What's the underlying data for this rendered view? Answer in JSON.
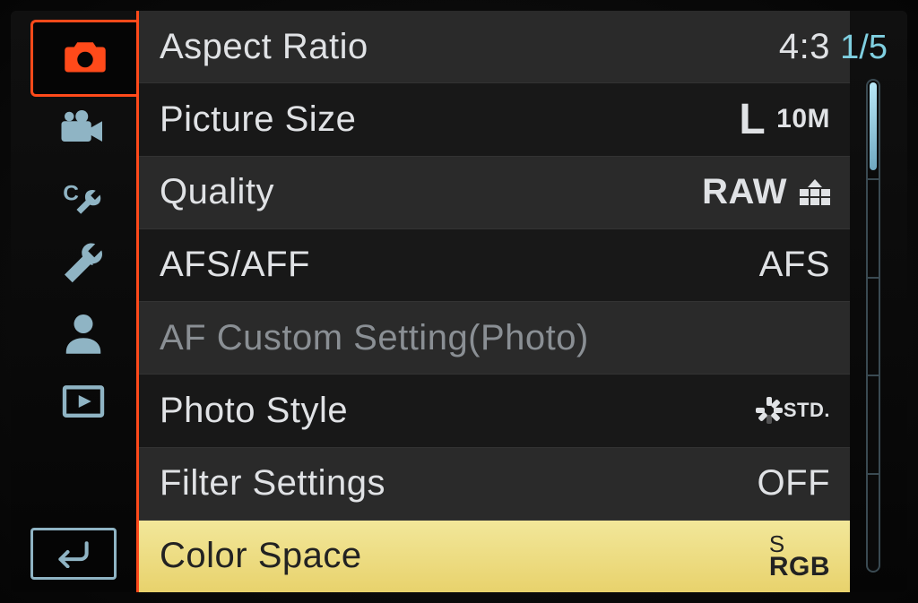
{
  "page_indicator": "1/5",
  "sidebar": {
    "tabs": [
      {
        "name": "camera",
        "active": true
      },
      {
        "name": "video",
        "active": false
      },
      {
        "name": "custom",
        "active": false
      },
      {
        "name": "setup",
        "active": false
      },
      {
        "name": "myMenu",
        "active": false
      },
      {
        "name": "playback",
        "active": false
      }
    ]
  },
  "menu": {
    "items": [
      {
        "label": "Aspect Ratio",
        "value": "4:3",
        "disabled": false,
        "selected": false,
        "icon": null
      },
      {
        "label": "Picture Size",
        "value_prefix": "L",
        "value_suffix": "10M",
        "disabled": false,
        "selected": false,
        "icon": "picture-size"
      },
      {
        "label": "Quality",
        "value": "RAW",
        "disabled": false,
        "selected": false,
        "icon": "quality"
      },
      {
        "label": "AFS/AFF",
        "value": "AFS",
        "disabled": false,
        "selected": false,
        "icon": null
      },
      {
        "label": "AF Custom Setting(Photo)",
        "value": "",
        "disabled": true,
        "selected": false,
        "icon": null
      },
      {
        "label": "Photo Style",
        "value": "STD.",
        "disabled": false,
        "selected": false,
        "icon": "photo-style"
      },
      {
        "label": "Filter Settings",
        "value": "OFF",
        "disabled": false,
        "selected": false,
        "icon": null
      },
      {
        "label": "Color Space",
        "value_sup": "S",
        "value_sub": "RGB",
        "disabled": false,
        "selected": true,
        "icon": "supsub"
      }
    ]
  },
  "back_label": "Back"
}
